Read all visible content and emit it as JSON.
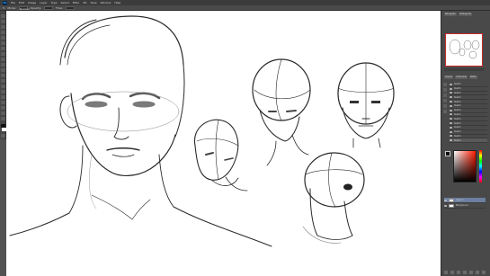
{
  "app": {
    "logo": "Ps"
  },
  "menu": {
    "items": [
      "File",
      "Edit",
      "Image",
      "Layer",
      "Type",
      "Select",
      "Filter",
      "3D",
      "View",
      "Window",
      "Help"
    ]
  },
  "options": {
    "items": [
      "Mode:",
      "Normal",
      "Opacity:",
      "Flow:"
    ]
  },
  "panels": {
    "top_tabs": [
      "Navigator",
      "Histogram"
    ],
    "layer_tabs": [
      "Layers",
      "Channels",
      "Paths"
    ]
  },
  "layers": {
    "sketch_rows": [
      "Sketch",
      "Sketch",
      "Sketch",
      "Sketch",
      "Sketch",
      "Sketch",
      "Sketch",
      "Sketch",
      "Sketch",
      "Sketch",
      "Sketch",
      "Sketch",
      "Sketch",
      "Sketch"
    ],
    "rows": [
      {
        "label": "Layer 1",
        "active": true
      },
      {
        "label": "Background",
        "active": false
      }
    ]
  },
  "colors": {
    "accent": "#c82b2b",
    "panel_bg": "#494949",
    "canvas": "#ffffff"
  }
}
